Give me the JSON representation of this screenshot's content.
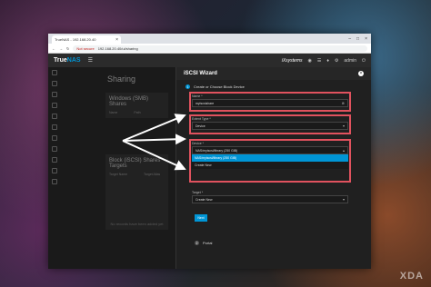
{
  "watermark": "XDA",
  "browser": {
    "tab_title": "TrueNAS - 192.168.20.40",
    "not_secure": "Not secure",
    "url": "192.168.20.40/ui/sharing"
  },
  "app": {
    "logo_main": "True",
    "logo_suffix": "NAS",
    "brand": "iXsystems",
    "user": "admin",
    "page_title": "Sharing",
    "smb_card_title": "Windows (SMB) Shares",
    "smb_col1": "Name",
    "smb_col2": "Path",
    "iscsi_card_title": "Block (iSCSI) Shares Targets",
    "iscsi_col1": "Target Name",
    "iscsi_col2": "Target Alias",
    "empty_text": "No records have been added yet"
  },
  "wizard": {
    "title": "iSCSI Wizard",
    "step1": "Create or Choose Block Device",
    "name_label": "Name *",
    "name_value": "myiscsishare",
    "type_label": "Extent Type *",
    "type_value": "Device",
    "device_label": "Device *",
    "device_options": [
      "NAS/myiscsi/library (250 GiB)",
      "NAS/myiscsi/library (250 GiB)",
      "Create New"
    ],
    "target_label": "Target *",
    "target_value": "Create New",
    "next": "Next",
    "step2": "Portal"
  },
  "colors": {
    "accent": "#0095d5",
    "highlight": "#e0525e"
  }
}
